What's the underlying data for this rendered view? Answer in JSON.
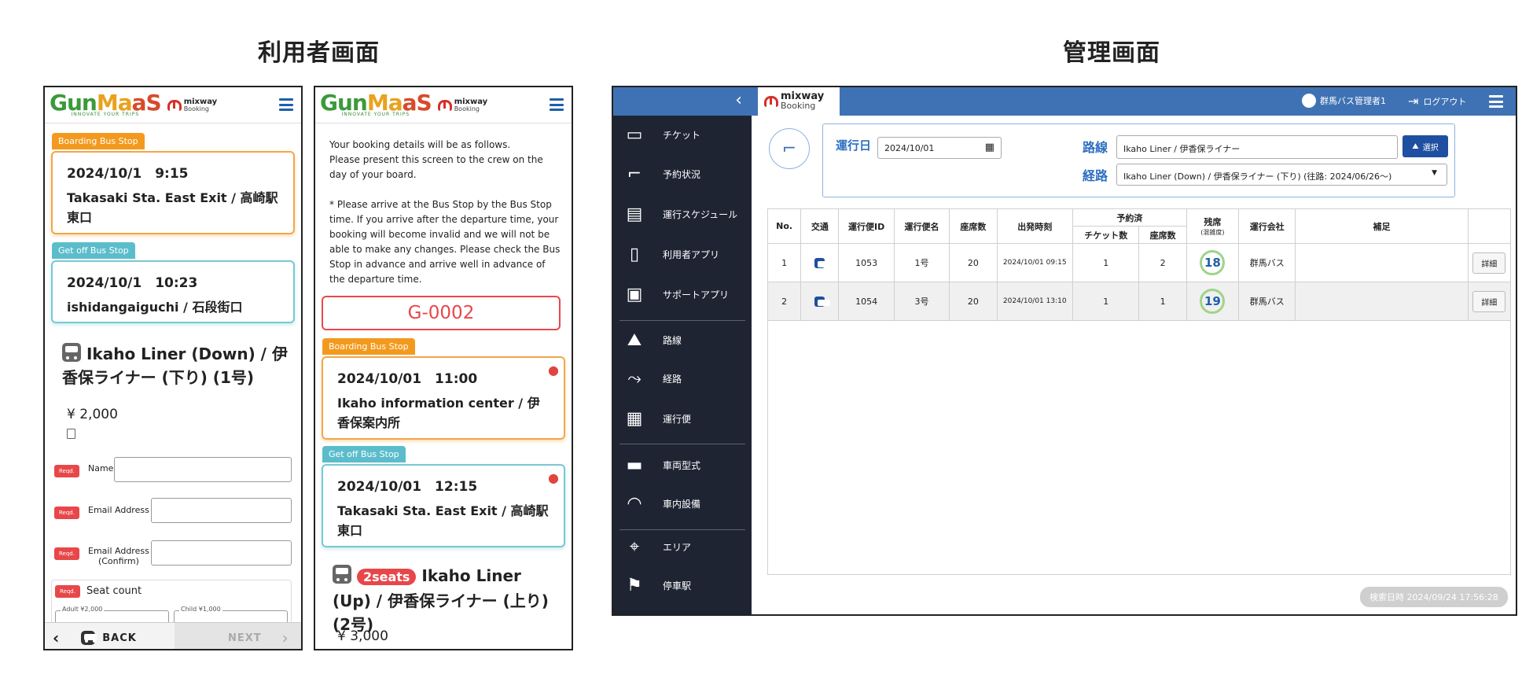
{
  "titles": {
    "user_screen": "利用者画面",
    "admin_screen": "管理画面"
  },
  "phone1": {
    "logo": "GunMaaS",
    "logo_sub": "INNOVATE YOUR TRIPS",
    "mx_brand": "mixway",
    "mx_sub": "Booking",
    "boarding_tag": "Boarding Bus Stop",
    "boarding_datetime": "2024/10/1　9:15",
    "boarding_place": "Takasaki Sta. East Exit / 高崎駅東口",
    "getoff_tag": "Get off Bus Stop",
    "getoff_datetime": "2024/10/1　10:23",
    "getoff_place": "ishidangaiguchi / 石段街口",
    "route": "Ikaho Liner (Down) / 伊香保ライナー (下り) (1号)",
    "price": "¥ 2,000",
    "reqd": "Reqd.",
    "name_label": "Name",
    "email_label": "Email Address",
    "email_confirm_label": "Email Address",
    "email_confirm_sub": "(Confirm)",
    "seat_count_label": "Seat count",
    "adult_label": "Adult ¥2,000",
    "child_label": "Child ¥1,000",
    "back_label": "BACK",
    "next_label": "NEXT"
  },
  "phone2": {
    "logo": "GunMaaS",
    "logo_sub": "INNOVATE YOUR TRIPS",
    "mx_brand": "mixway",
    "mx_sub": "Booking",
    "intro_line1": "Your booking details will be as follows.",
    "intro_line2": "Please present this screen to the crew on the day of your board.",
    "notice": "* Please arrive at the Bus Stop by the Bus Stop time. If you arrive after the departure time, your booking will become invalid and we will not be able to make any changes. Please check the Bus Stop in advance and arrive well in advance of the departure time.",
    "booking_code": "G-0002",
    "boarding_tag": "Boarding Bus Stop",
    "boarding_datetime": "2024/10/01　11:00",
    "boarding_place": "Ikaho information center / 伊香保案内所",
    "getoff_tag": "Get off Bus Stop",
    "getoff_datetime": "2024/10/01　12:15",
    "getoff_place": "Takasaki Sta. East Exit / 高崎駅東口",
    "seats_badge": "2seats",
    "route": "Ikaho Liner (Up) / 伊香保ライナー (上り) (2号)",
    "price": "¥ 3,000"
  },
  "admin": {
    "brand": "mixway",
    "brand_sub": "Booking",
    "user": "群馬バス管理者1",
    "logout": "ログアウト",
    "sidebar": [
      {
        "label": "チケット",
        "icon": "ticket-icon",
        "glyph": "▭"
      },
      {
        "label": "予約状況",
        "icon": "seat-icon",
        "glyph": "⌐"
      },
      {
        "label": "運行スケジュール",
        "icon": "schedule-icon",
        "glyph": "▤"
      },
      {
        "label": "利用者アプリ",
        "icon": "smartphone-icon",
        "glyph": "▯"
      },
      {
        "label": "サポートアプリ",
        "icon": "support-app-icon",
        "glyph": "▣"
      },
      {
        "label": "路線",
        "icon": "road-icon",
        "glyph": "⛰"
      },
      {
        "label": "経路",
        "icon": "route-icon",
        "glyph": "⤳"
      },
      {
        "label": "運行便",
        "icon": "bus-icon",
        "glyph": "▦"
      },
      {
        "label": "車両型式",
        "icon": "vehicle-type-icon",
        "glyph": "▬"
      },
      {
        "label": "車内設備",
        "icon": "wifi-icon",
        "glyph": "◠"
      },
      {
        "label": "エリア",
        "icon": "area-map-icon",
        "glyph": "⌖"
      },
      {
        "label": "停車駅",
        "icon": "bus-stop-icon",
        "glyph": "⚑"
      }
    ],
    "filter": {
      "date_label": "運行日",
      "date_value": "2024/10/01",
      "line_label": "路線",
      "line_value": "Ikaho Liner / 伊香保ライナー",
      "select_btn": "選択",
      "route_label": "経路",
      "route_value": "Ikaho Liner (Down) / 伊香保ライナー (下り) (往路: 2024/06/26〜)"
    },
    "table": {
      "headers": {
        "no": "No.",
        "transport": "交通",
        "trip_id": "運行便ID",
        "trip_name": "運行便名",
        "seats": "座席数",
        "departure": "出発時刻",
        "reserved": "予約済",
        "tickets": "チケット数",
        "reserved_seats": "座席数",
        "remaining": "残席",
        "remaining_sub": "(混雑度)",
        "company": "運行会社",
        "notes": "補足"
      },
      "rows": [
        {
          "no": "1",
          "trip_id": "1053",
          "trip_name": "1号",
          "seats": "20",
          "departure": "2024/10/01 09:15",
          "tickets": "1",
          "reserved_seats": "2",
          "remaining": "18",
          "company": "群馬バス",
          "detail": "詳細"
        },
        {
          "no": "2",
          "trip_id": "1054",
          "trip_name": "3号",
          "seats": "20",
          "departure": "2024/10/01 13:10",
          "tickets": "1",
          "reserved_seats": "1",
          "remaining": "19",
          "company": "群馬バス",
          "detail": "詳細"
        }
      ]
    },
    "search_time": "検索日時 2024/09/24 17:56:28",
    "colors": {
      "brand_blue": "#3f72b4",
      "sidebar": "#1f2433",
      "boarding": "#f39a1e",
      "getoff": "#5bbdcc",
      "alert_red": "#e8474a"
    }
  }
}
